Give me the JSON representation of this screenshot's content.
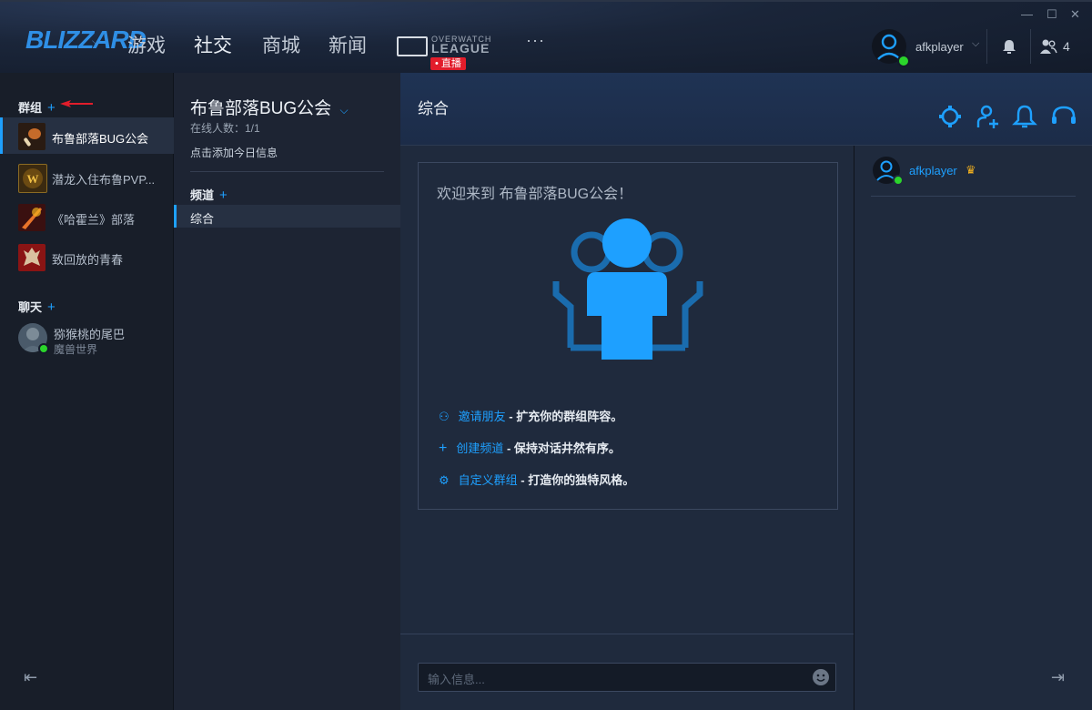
{
  "topnav": {
    "logo": "BLIZZARD",
    "items": [
      "游戏",
      "社交",
      "商城",
      "新闻"
    ],
    "owl_top": "OVERWATCH",
    "owl_bottom": "LEAGUE",
    "live_badge": "• 直播",
    "more": "···"
  },
  "user": {
    "name": "afkplayer",
    "friends_online": "4",
    "status_color": "#2bd52b"
  },
  "sidebar": {
    "groups_heading": "群组",
    "groups": [
      {
        "label": "布鲁部落BUG公会",
        "selected": true,
        "icon": "drumstick-icon"
      },
      {
        "label": "潜龙入住布鲁PVP...",
        "selected": false,
        "icon": "wow-logo-icon"
      },
      {
        "label": "《哈霍兰》部落",
        "selected": false,
        "icon": "fire-weapon-icon"
      },
      {
        "label": "致回放的青春",
        "selected": false,
        "icon": "horde-icon"
      }
    ],
    "chat_heading": "聊天",
    "chat": {
      "name": "猕猴桃的尾巴",
      "subtitle": "魔兽世界"
    }
  },
  "guild": {
    "name": "布鲁部落BUG公会",
    "online_count": "在线人数：1/1",
    "add_info": "点击添加今日信息",
    "channels_heading": "频道",
    "channels": [
      "综合"
    ]
  },
  "channel": {
    "title": "综合",
    "welcome": "欢迎来到 布鲁部落BUG公会！",
    "tips": [
      {
        "link": "邀请朋友",
        "text": " - 扩充你的群组阵容。",
        "icon": "invite-friend-icon"
      },
      {
        "link": "创建频道",
        "text": " - 保持对话井然有序。",
        "icon": "plus-icon"
      },
      {
        "link": "自定义群组",
        "text": " - 打造你的独特风格。",
        "icon": "gear-icon"
      }
    ],
    "input_placeholder": "输入信息..."
  },
  "members": [
    {
      "name": "afkplayer",
      "is_owner": true
    }
  ],
  "colors": {
    "accent": "#1ea0ff",
    "live": "#e21d2b",
    "online": "#2bd52b",
    "crown": "#f2b01e"
  }
}
